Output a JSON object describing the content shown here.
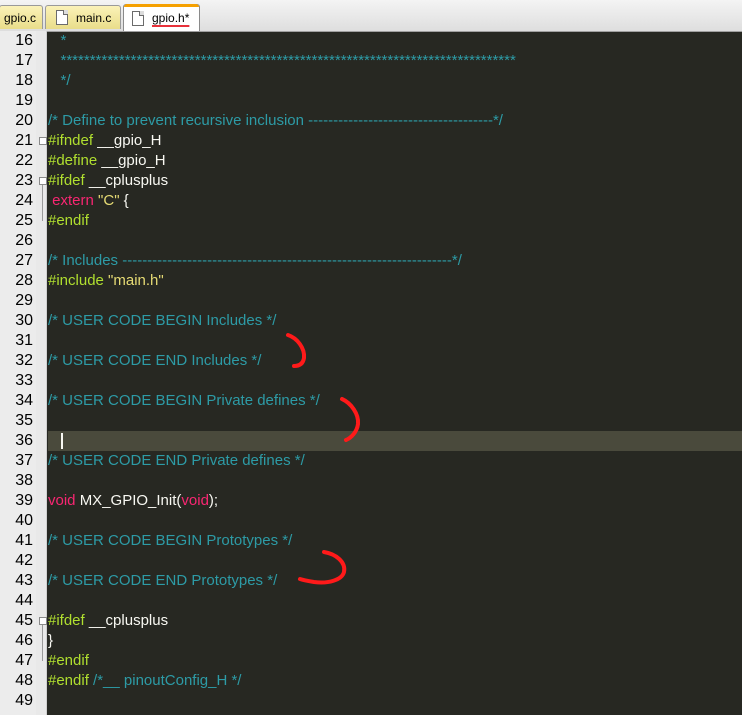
{
  "tabs": [
    {
      "label": "gpio.c"
    },
    {
      "label": "main.c"
    },
    {
      "label": "gpio.h*"
    }
  ],
  "lines": [
    {
      "num": "16",
      "segments": [
        {
          "cls": "cm",
          "text": "   *"
        }
      ]
    },
    {
      "num": "17",
      "segments": [
        {
          "cls": "cm",
          "text": "   ******************************************************************************"
        }
      ]
    },
    {
      "num": "18",
      "segments": [
        {
          "cls": "cm",
          "text": "   */"
        }
      ]
    },
    {
      "num": "19",
      "segments": []
    },
    {
      "num": "20",
      "segments": [
        {
          "cls": "cm",
          "text": "/* Define to prevent recursive inclusion -------------------------------------*/"
        }
      ]
    },
    {
      "num": "21",
      "segments": [
        {
          "cls": "pp",
          "text": "#ifndef "
        },
        {
          "cls": "tx",
          "text": "__gpio_H"
        }
      ]
    },
    {
      "num": "22",
      "segments": [
        {
          "cls": "pp",
          "text": "#define "
        },
        {
          "cls": "tx",
          "text": "__gpio_H"
        }
      ]
    },
    {
      "num": "23",
      "segments": [
        {
          "cls": "pp",
          "text": "#ifdef "
        },
        {
          "cls": "tx",
          "text": "__cplusplus"
        }
      ]
    },
    {
      "num": "24",
      "segments": [
        {
          "cls": "kw",
          "text": " extern "
        },
        {
          "cls": "str",
          "text": "\"C\""
        },
        {
          "cls": "tx",
          "text": " {"
        }
      ]
    },
    {
      "num": "25",
      "segments": [
        {
          "cls": "pp",
          "text": "#endif"
        }
      ]
    },
    {
      "num": "26",
      "segments": []
    },
    {
      "num": "27",
      "segments": [
        {
          "cls": "cm",
          "text": "/* Includes ------------------------------------------------------------------*/"
        }
      ]
    },
    {
      "num": "28",
      "segments": [
        {
          "cls": "pp",
          "text": "#include "
        },
        {
          "cls": "str",
          "text": "\"main.h\""
        }
      ]
    },
    {
      "num": "29",
      "segments": []
    },
    {
      "num": "30",
      "segments": [
        {
          "cls": "cm",
          "text": "/* USER CODE BEGIN Includes */"
        }
      ]
    },
    {
      "num": "31",
      "segments": []
    },
    {
      "num": "32",
      "segments": [
        {
          "cls": "cm",
          "text": "/* USER CODE END Includes */"
        }
      ]
    },
    {
      "num": "33",
      "segments": []
    },
    {
      "num": "34",
      "segments": [
        {
          "cls": "cm",
          "text": "/* USER CODE BEGIN Private defines */"
        }
      ]
    },
    {
      "num": "35",
      "segments": []
    },
    {
      "num": "36",
      "segments": [],
      "current": true
    },
    {
      "num": "37",
      "segments": [
        {
          "cls": "cm",
          "text": "/* USER CODE END Private defines */"
        }
      ]
    },
    {
      "num": "38",
      "segments": []
    },
    {
      "num": "39",
      "segments": [
        {
          "cls": "kw",
          "text": "void "
        },
        {
          "cls": "tx",
          "text": "MX_GPIO_Init("
        },
        {
          "cls": "kw",
          "text": "void"
        },
        {
          "cls": "tx",
          "text": ");"
        }
      ]
    },
    {
      "num": "40",
      "segments": []
    },
    {
      "num": "41",
      "segments": [
        {
          "cls": "cm",
          "text": "/* USER CODE BEGIN Prototypes */"
        }
      ]
    },
    {
      "num": "42",
      "segments": []
    },
    {
      "num": "43",
      "segments": [
        {
          "cls": "cm",
          "text": "/* USER CODE END Prototypes */"
        }
      ]
    },
    {
      "num": "44",
      "segments": []
    },
    {
      "num": "45",
      "segments": [
        {
          "cls": "pp",
          "text": "#ifdef "
        },
        {
          "cls": "tx",
          "text": "__cplusplus"
        }
      ]
    },
    {
      "num": "46",
      "segments": [
        {
          "cls": "tx",
          "text": "}"
        }
      ]
    },
    {
      "num": "47",
      "segments": [
        {
          "cls": "pp",
          "text": "#endif"
        }
      ]
    },
    {
      "num": "48",
      "segments": [
        {
          "cls": "pp",
          "text": "#endif "
        },
        {
          "cls": "cm",
          "text": "/*__ pinoutConfig_H */"
        }
      ]
    },
    {
      "num": "49",
      "segments": []
    }
  ],
  "colors": {
    "background": "#272822",
    "comment": "#2d9ba6",
    "preprocessor": "#b0df2f",
    "keyword": "#f92672",
    "string": "#e6db74",
    "text": "#f8f8f2",
    "annotation": "#ff1a1a"
  }
}
